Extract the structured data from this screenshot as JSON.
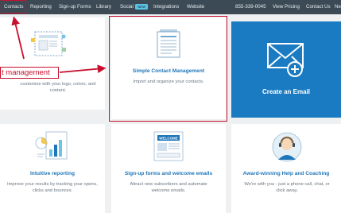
{
  "nav": {
    "items": [
      {
        "label": "Contacts"
      },
      {
        "label": "Reporting"
      },
      {
        "label": "Sign-up Forms"
      },
      {
        "label": "Library"
      },
      {
        "label": "Social",
        "badge": "NEW"
      },
      {
        "label": "Integrations"
      },
      {
        "label": "Website"
      }
    ],
    "phone": "855-339-0045",
    "view_pricing": "View Pricing",
    "contact_us": "Contact Us",
    "partial": "Ne"
  },
  "cards": {
    "templates": {
      "desc": "customize with your logo, colors, and content."
    },
    "contact_mgmt": {
      "title": "Simple Contact Management",
      "desc": "Import and organize your contacts."
    },
    "create_email": {
      "title": "Create an Email"
    },
    "reporting": {
      "title": "Intuitive reporting",
      "desc": "Improve your results by tracking your opens, clicks and bounces."
    },
    "signup": {
      "title": "Sign-up forms and welcome emails",
      "desc": "Attract new subscribers and automate welcome emails.",
      "icon_label": "WELCOME"
    },
    "help": {
      "title": "Award-winning Help and Coaching",
      "desc": "We're with you - just a phone call, chat, or click away."
    }
  },
  "annotation": {
    "text": "t management"
  },
  "colors": {
    "accent": "#1f76b8",
    "highlight": "#c8102e",
    "nav_bg": "#3b4a55",
    "email_card": "#1a7bc2"
  }
}
